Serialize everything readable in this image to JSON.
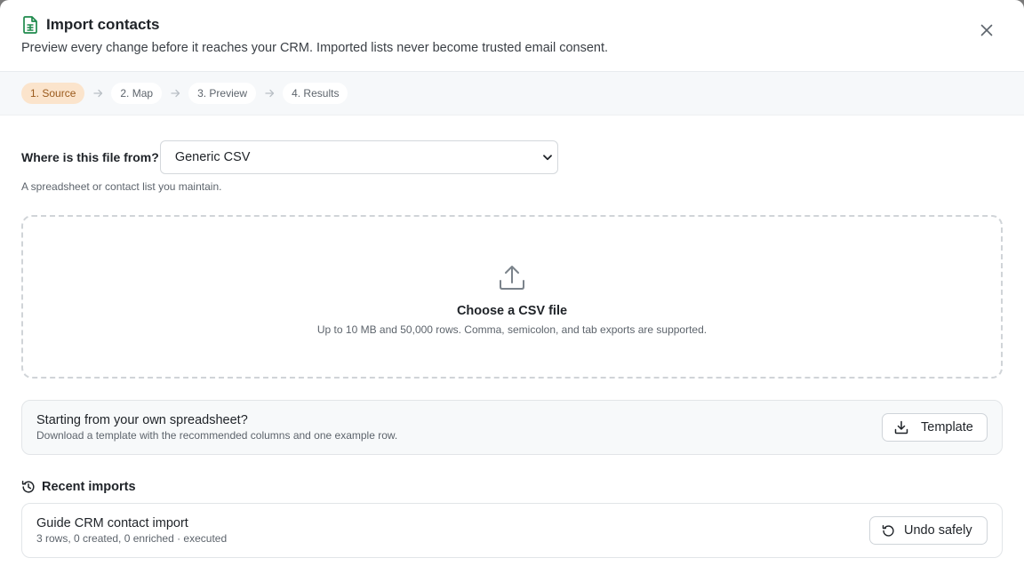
{
  "header": {
    "title": "Import contacts",
    "subtitle": "Preview every change before it reaches your CRM. Imported lists never become trusted email consent.",
    "title_icon": "spreadsheet-icon",
    "close_icon": "close-icon"
  },
  "stepper": {
    "steps": [
      {
        "label": "1. Source",
        "active": true
      },
      {
        "label": "2. Map",
        "active": false
      },
      {
        "label": "3. Preview",
        "active": false
      },
      {
        "label": "4. Results",
        "active": false
      }
    ]
  },
  "source": {
    "label": "Where is this file from?",
    "selected": "Generic CSV",
    "hint": "A spreadsheet or contact list you maintain."
  },
  "dropzone": {
    "icon": "upload-icon",
    "title": "Choose a CSV file",
    "hint": "Up to 10 MB and 50,000 rows. Comma, semicolon, and tab exports are supported."
  },
  "template_card": {
    "title": "Starting from your own spreadsheet?",
    "subtitle": "Download a template with the recommended columns and one example row.",
    "button_label": "Template",
    "button_icon": "download-icon"
  },
  "recent": {
    "title": "Recent imports",
    "icon": "history-icon",
    "items": [
      {
        "title": "Guide CRM contact import",
        "meta": "3 rows, 0 created, 0 enriched · executed",
        "action_label": "Undo safely",
        "action_icon": "undo-icon"
      }
    ]
  },
  "colors": {
    "accent_green": "#1f8a4c",
    "active_step_bg": "#fbe4cc",
    "active_step_text": "#9a5a1c"
  }
}
